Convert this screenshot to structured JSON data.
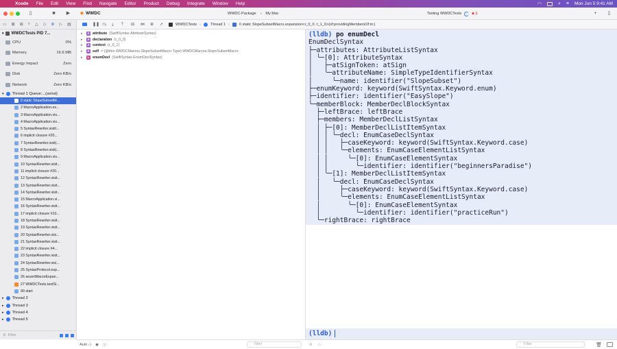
{
  "menubar": {
    "apple": "",
    "items": [
      "Xcode",
      "File",
      "Edit",
      "View",
      "Find",
      "Navigate",
      "Editor",
      "Product",
      "Debug",
      "Integrate",
      "Window",
      "Help"
    ],
    "clock": "Mon Jun 5  9:41 AM"
  },
  "toolbar": {
    "project": "WWDC",
    "scheme": "WWDC-Package",
    "destination": "My Mac",
    "status": "Testing WWDCTests",
    "error_count": "1"
  },
  "navigator": {
    "process": "WWDCTests PID 7...",
    "gauges": [
      {
        "label": "CPU",
        "value": "0%"
      },
      {
        "label": "Memory",
        "value": "16.6 MB"
      },
      {
        "label": "Energy Impact",
        "value": "Zero"
      },
      {
        "label": "Disk",
        "value": "Zero KB/s"
      },
      {
        "label": "Network",
        "value": "Zero KB/s"
      }
    ],
    "thread1": "Thread 1 Queue:...(serial)",
    "frames": [
      "0 static SlopeSubsetM...",
      "2 MacroApplication.ex...",
      "3 MacroApplication.vis...",
      "4 MacroApplication.vis...",
      "5 SyntaxRewriter.visitI...",
      "6 implicit closure #20...",
      "7 SyntaxRewriter.visit(...",
      "8 SyntaxRewriter.visit(...",
      "9 MacroApplication.vis...",
      "10 SyntaxRewriter.visit...",
      "11 implicit closure #20...",
      "12 SyntaxRewriter.visit...",
      "13 SyntaxRewriter.visit...",
      "14 SyntaxRewriter.visit...",
      "15 MacroApplication.vi...",
      "16 SyntaxRewriter.visit...",
      "17 implicit closure #10...",
      "18 SyntaxRewriter.visit...",
      "19 SyntaxRewriter.visit...",
      "20 SyntaxRewriter.visi...",
      "21 SyntaxRewriter.visit...",
      "22 implicit closure #4...",
      "23 SyntaxRewriter.visit...",
      "24 SyntaxRewriter.visi...",
      "25 SyntaxProtocol.exp...",
      "26 assertMacroExpan...",
      "27 WWDCTests.testSl...",
      "90 start"
    ],
    "threads": [
      "Thread 2",
      "Thread 3",
      "Thread 4",
      "Thread 5"
    ],
    "filter_placeholder": "Filter"
  },
  "debugbar": {
    "crumbs": [
      "WWDCTests",
      "Thread 1",
      "0 static SlopeSubsetMacro.expansion<τ_0_0, τ_1_0>(of:providingMembersOf:in:)"
    ]
  },
  "variables": [
    {
      "badge": "A",
      "name": "attribute",
      "type": "(SwiftSyntax.AttributeSyntax)"
    },
    {
      "badge": "A",
      "name": "declaration",
      "type": "(τ_0_0)"
    },
    {
      "badge": "A",
      "name": "context",
      "type": "(τ_0_1)"
    },
    {
      "badge": "A",
      "name": "self",
      "type": "= (@thin WWDCMacros.SlopeSubsetMacro.Type) WWDCMacros.SlopeSubsetMacro"
    },
    {
      "badge": "L",
      "name": "enumDecl",
      "type": "(SwiftSyntax.EnumDeclSyntax)"
    }
  ],
  "vars_footer": {
    "mode": "Auto ◇",
    "filter_placeholder": "Filter"
  },
  "console": {
    "prompt": "(lldb)",
    "command": "po enumDecl",
    "output": [
      "EnumDeclSyntax",
      "├─attributes: AttributeListSyntax",
      "│ ╰─[0]: AttributeSyntax",
      "│   ├─atSignToken: atSign",
      "│   ╰─attributeName: SimpleTypeIdentifierSyntax",
      "│     ╰─name: identifier(\"SlopeSubset\")",
      "├─enumKeyword: keyword(SwiftSyntax.Keyword.enum)",
      "├─identifier: identifier(\"EasySlope\")",
      "╰─memberBlock: MemberDeclBlockSyntax",
      "  ├─leftBrace: leftBrace",
      "  ├─members: MemberDeclListSyntax",
      "  │ ├─[0]: MemberDeclListItemSyntax",
      "  │ │ ╰─decl: EnumCaseDeclSyntax",
      "  │ │   ├─caseKeyword: keyword(SwiftSyntax.Keyword.case)",
      "  │ │   ╰─elements: EnumCaseElementListSyntax",
      "  │ │     ╰─[0]: EnumCaseElementSyntax",
      "  │ │       ╰─identifier: identifier(\"beginnersParadise\")",
      "  │ ╰─[1]: MemberDeclListItemSyntax",
      "  │   ╰─decl: EnumCaseDeclSyntax",
      "  │     ├─caseKeyword: keyword(SwiftSyntax.Keyword.case)",
      "  │     ╰─elements: EnumCaseElementListSyntax",
      "  │       ╰─[0]: EnumCaseElementSyntax",
      "  │         ╰─identifier: identifier(\"practiceRun\")",
      "  ╰─rightBrace: rightBrace"
    ],
    "filter_placeholder": "Filter"
  }
}
